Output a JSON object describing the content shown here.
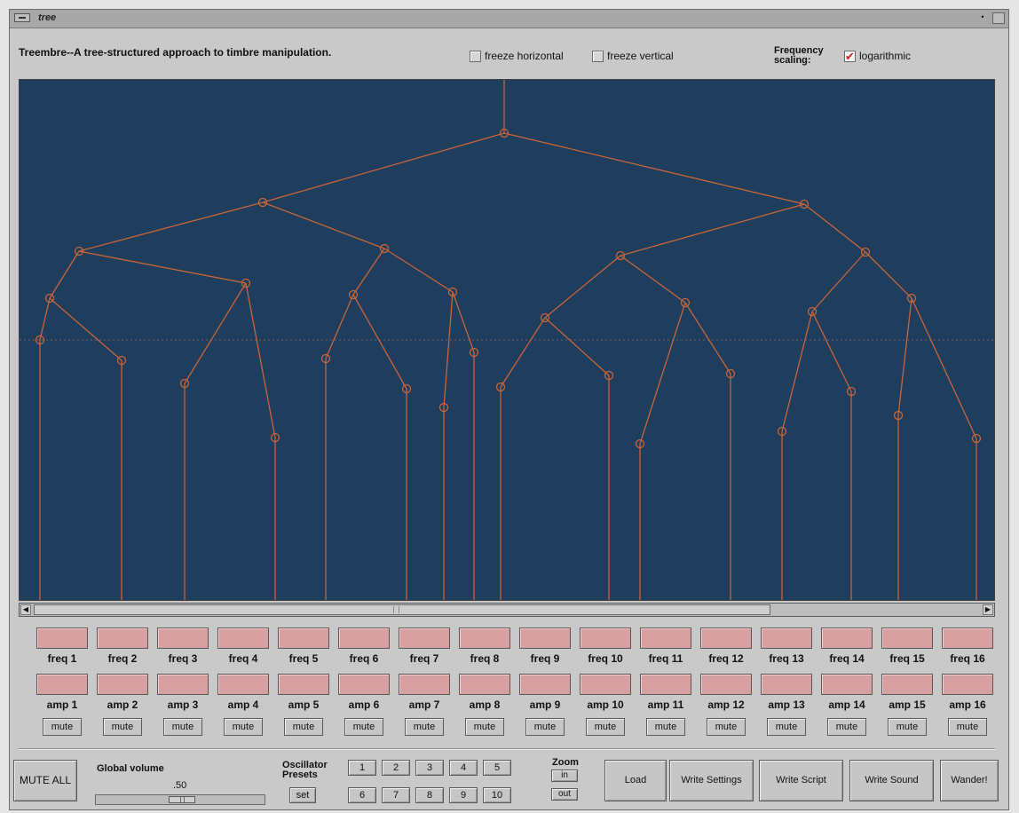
{
  "window": {
    "title": "tree"
  },
  "header": {
    "app_title": "Treembre--A tree-structured approach to timbre manipulation.",
    "freeze_horizontal": {
      "label": "freeze horizontal",
      "checked": false
    },
    "freeze_vertical": {
      "label": "freeze vertical",
      "checked": false
    },
    "frequency_scaling": {
      "label_line1": "Frequency",
      "label_line2": "scaling:",
      "option": "logarithmic",
      "checked": true
    }
  },
  "tree_colors": {
    "background": "#1f3d5c",
    "edge": "#c8643a",
    "dotted_line": "#7a6060"
  },
  "oscillators": {
    "freq_labels": [
      "freq 1",
      "freq 2",
      "freq 3",
      "freq 4",
      "freq 5",
      "freq 6",
      "freq 7",
      "freq 8",
      "freq 9",
      "freq 10",
      "freq 11",
      "freq 12",
      "freq 13",
      "freq 14",
      "freq 15",
      "freq 16"
    ],
    "amp_labels": [
      "amp 1",
      "amp 2",
      "amp 3",
      "amp 4",
      "amp 5",
      "amp 6",
      "amp 7",
      "amp 8",
      "amp 9",
      "amp 10",
      "amp 11",
      "amp 12",
      "amp 13",
      "amp 14",
      "amp 15",
      "amp 16"
    ],
    "mute_label": "mute"
  },
  "bottom": {
    "mute_all": "MUTE ALL",
    "global_volume_label": "Global volume",
    "global_volume_value": ".50",
    "presets_label_line1": "Oscillator",
    "presets_label_line2": "Presets",
    "preset_buttons_row1": [
      "1",
      "2",
      "3",
      "4",
      "5"
    ],
    "preset_buttons_row2": [
      "6",
      "7",
      "8",
      "9",
      "10"
    ],
    "set_label": "set",
    "zoom_label": "Zoom",
    "zoom_in": "in",
    "zoom_out": "out",
    "load": "Load",
    "write_settings": "Write Settings",
    "write_script": "Write Script",
    "write_sound": "Write Sound",
    "wander": "Wander!"
  }
}
